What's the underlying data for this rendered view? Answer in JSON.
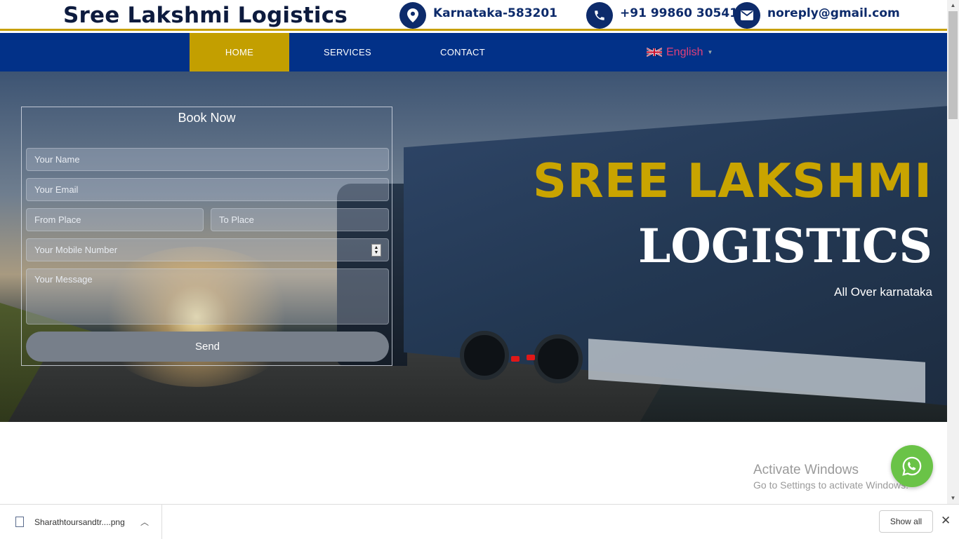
{
  "header": {
    "brand": "Sree Lakshmi Logistics",
    "location": "Karnataka-583201",
    "phone": "+91 99860 30541",
    "email": "noreply@gmail.com"
  },
  "nav": {
    "items": [
      {
        "label": "HOME",
        "active": true
      },
      {
        "label": "SERVICES",
        "active": false
      },
      {
        "label": "CONTACT",
        "active": false
      }
    ],
    "language": "English"
  },
  "booking": {
    "title": "Book Now",
    "name_placeholder": "Your Name",
    "email_placeholder": "Your Email",
    "from_placeholder": "From Place",
    "to_placeholder": "To Place",
    "mobile_placeholder": "Your Mobile Number",
    "message_placeholder": "Your Message",
    "send_label": "Send"
  },
  "hero": {
    "line1": "SREE LAKSHMI",
    "line2": "LOGISTICS",
    "tagline": "All Over karnataka"
  },
  "watermark": {
    "title": "Activate Windows",
    "subtitle": "Go to Settings to activate Windows."
  },
  "downloads": {
    "file_name": "Sharathtoursandtr....png",
    "show_all": "Show all"
  },
  "colors": {
    "navy": "#023188",
    "gold": "#c39f00",
    "whatsapp": "#6ac347"
  },
  "icons": [
    "location-icon",
    "phone-icon",
    "mail-icon",
    "uk-flag-icon",
    "whatsapp-icon",
    "file-icon",
    "chevron-up-icon",
    "close-icon"
  ]
}
